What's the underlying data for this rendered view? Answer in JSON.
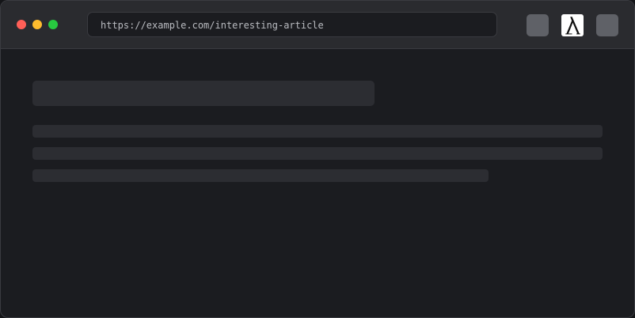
{
  "browser": {
    "url": "https://example.com/interesting-article",
    "traffic_lights": {
      "close_color": "#ff5f57",
      "minimize_color": "#febc2e",
      "maximize_color": "#28c840"
    },
    "extension_icon": "lambda-logo-icon"
  },
  "page": {
    "state": "loading-skeleton"
  },
  "colors": {
    "window_bg": "#1b1c20",
    "titlebar_bg": "#2a2b2f",
    "skeleton": "#2c2d32",
    "toolbar_button": "#5f6167"
  }
}
